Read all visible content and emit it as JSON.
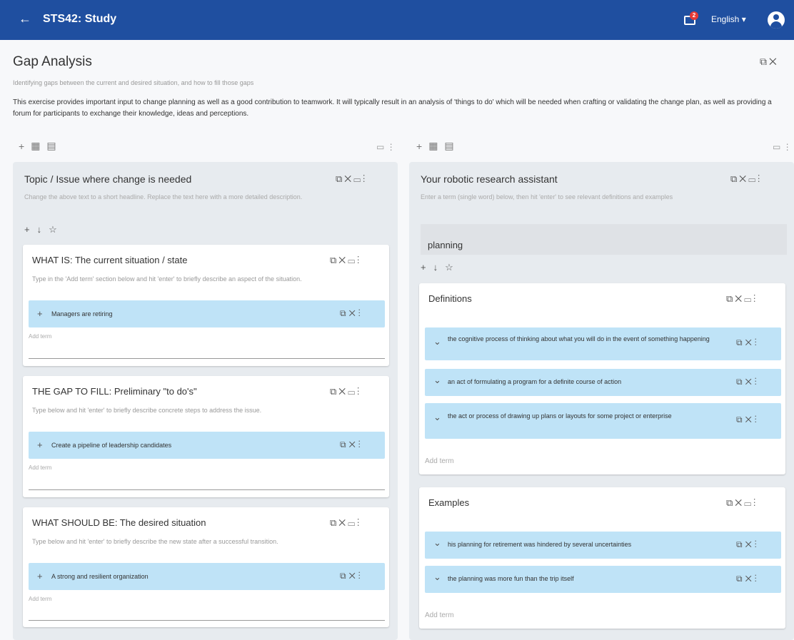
{
  "header": {
    "back_icon": "arrow-left-icon",
    "title": "STS42: Study",
    "notification_count": "2",
    "language": "English ▾",
    "colors": {
      "bar": "#1f4fa0",
      "badge": "#e53935"
    }
  },
  "page": {
    "title": "Gap Analysis",
    "subtitle": "Identifying gaps between the current and desired situation, and how to fill those gaps",
    "description": "This exercise provides important input to change planning as well as a good contribution to teamwork. It will typically result in an analysis of 'things to do' which will be needed when crafting or validating the change plan, as well as providing a forum for participants to exchange their knowledge, ideas and perceptions."
  },
  "left": {
    "title": "Topic / Issue where change is needed",
    "desc": "Change the above text to a short headline. Replace the text here with a more detailed description.",
    "cards": [
      {
        "title": "WHAT IS:  The current situation / state",
        "desc": "Type in the 'Add term' section below and hit 'enter' to briefly describe an aspect of the situation.",
        "term": "Managers are retiring",
        "add": "Add term"
      },
      {
        "title": "THE GAP TO FILL: Preliminary \"to do's\"",
        "desc": "Type below and hit 'enter' to briefly describe concrete steps to address the issue.",
        "term": "Create a pipeline of leadership candidates",
        "add": "Add term"
      },
      {
        "title": "WHAT SHOULD BE: The desired situation",
        "desc": "Type below and hit 'enter' to briefly describe the new state after a successful transition.",
        "term": "A strong and resilient organization",
        "add": "Add term"
      }
    ]
  },
  "right": {
    "title": "Your robotic research assistant",
    "desc": "Enter a term (single word) below, then hit 'enter' to see relevant definitions and examples",
    "search_value": "planning",
    "definitions": {
      "title": "Definitions",
      "items": [
        "the cognitive process of thinking about what you will do in the event of something happening",
        "an act of formulating a program for a definite course of action",
        "the act or process of drawing up plans or layouts for some project or enterprise"
      ],
      "add": "Add term"
    },
    "examples": {
      "title": "Examples",
      "items": [
        "his planning for retirement was hindered by several uncertainties",
        "the planning was more fun than the trip itself"
      ],
      "add": "Add term"
    }
  }
}
